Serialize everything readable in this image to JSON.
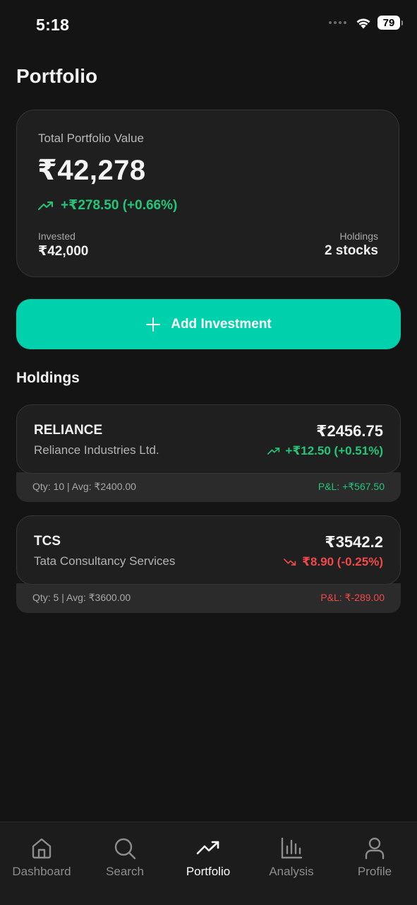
{
  "status_bar": {
    "time": "5:18",
    "battery": "79"
  },
  "page": {
    "title": "Portfolio"
  },
  "summary": {
    "label": "Total Portfolio Value",
    "value": "₹42,278",
    "change": "+₹278.50 (+0.66%)",
    "invested_label": "Invested",
    "invested_value": "₹42,000",
    "holdings_label": "Holdings",
    "holdings_value": "2 stocks"
  },
  "add_button": {
    "label": "Add Investment"
  },
  "holdings": {
    "heading": "Holdings",
    "items": [
      {
        "symbol": "RELIANCE",
        "name": "Reliance Industries Ltd.",
        "price": "₹2456.75",
        "change": "+₹12.50 (+0.51%)",
        "qty_avg": "Qty: 10 | Avg: ₹2400.00",
        "pnl": "P&L: +₹567.50",
        "direction": "up"
      },
      {
        "symbol": "TCS",
        "name": "Tata Consultancy Services",
        "price": "₹3542.2",
        "change": "₹8.90 (-0.25%)",
        "qty_avg": "Qty: 5 | Avg: ₹3600.00",
        "pnl": "P&L: ₹-289.00",
        "direction": "down"
      }
    ]
  },
  "nav": {
    "items": [
      {
        "label": "Dashboard",
        "icon": "home-icon"
      },
      {
        "label": "Search",
        "icon": "search-icon"
      },
      {
        "label": "Portfolio",
        "icon": "trending-up-icon",
        "active": true
      },
      {
        "label": "Analysis",
        "icon": "bar-chart-icon"
      },
      {
        "label": "Profile",
        "icon": "user-icon"
      }
    ]
  },
  "colors": {
    "background": "#141414",
    "card": "#1f1f1f",
    "accent": "#00d1ad",
    "positive": "#22c67a",
    "negative": "#f04848"
  }
}
